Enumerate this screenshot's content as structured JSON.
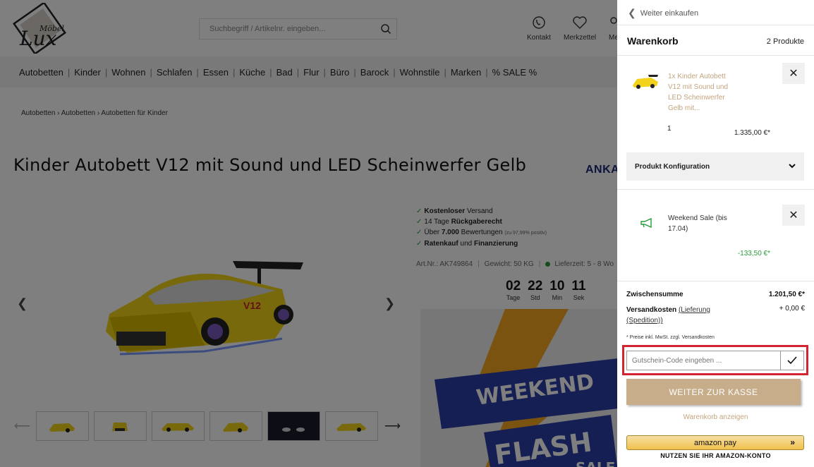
{
  "header": {
    "logo_text": "Möbel Lux",
    "search_placeholder": "Suchbegriff / Artikelnr. eingeben...",
    "icons": [
      {
        "label": "Kontakt",
        "icon": "phone-icon"
      },
      {
        "label": "Merkzettel",
        "icon": "heart-icon"
      },
      {
        "label": "Me",
        "icon": "user-icon"
      }
    ]
  },
  "nav": [
    "Autobetten",
    "Kinder",
    "Wohnen",
    "Schlafen",
    "Essen",
    "Küche",
    "Bad",
    "Flur",
    "Büro",
    "Barock",
    "Wohnstile",
    "Marken",
    "% SALE %"
  ],
  "breadcrumb": "Autobetten › Autobetten › Autobetten für Kinder",
  "product": {
    "title": "Kinder Autobett V12 mit Sound und LED Scheinwerfer Gelb",
    "brand": "ANKA",
    "features": [
      {
        "pre": "",
        "bold": "Kostenloser",
        "post": " Versand",
        "small": ""
      },
      {
        "pre": "14 Tage ",
        "bold": "Rückgaberecht",
        "post": "",
        "small": ""
      },
      {
        "pre": "Über ",
        "bold": "7.000",
        "post": " Bewertungen ",
        "small": "(zu 97,99% positiv)"
      },
      {
        "pre": "",
        "bold": "Ratenkauf",
        "post": " und ",
        "small": "",
        "bold2": "Finanzierung"
      }
    ],
    "art_nr": "Art.Nr.: AK749864",
    "weight": "Gewicht: 50 KG",
    "delivery": "Lieferzeit: 5 - 8 Wo",
    "countdown": [
      {
        "value": "02",
        "label": "Tage"
      },
      {
        "value": "22",
        "label": "Std"
      },
      {
        "value": "10",
        "label": "Min"
      },
      {
        "value": "11",
        "label": "Sek"
      }
    ],
    "banner_words": [
      "WEEKEND",
      "FLASH",
      "SALE"
    ]
  },
  "cart": {
    "back_label": "Weiter einkaufen",
    "title": "Warenkorb",
    "count": "2 Produkte",
    "item": {
      "name": "1x Kinder Autobett V12 mit Sound und LED Scheinwerfer Gelb mit...",
      "qty": "1",
      "price": "1.335,00 €*"
    },
    "config_label": "Produkt Konfiguration",
    "promo": {
      "name": "Weekend Sale (bis 17.04)",
      "price": "-133,50 €*"
    },
    "subtotal_label": "Zwischensumme",
    "subtotal_value": "1.201,50 €*",
    "shipping_label": "Versandkosten",
    "shipping_link": "(Lieferung (Spedition))",
    "shipping_value": "+ 0,00 €",
    "note": "* Preise inkl. MwSt. zzgl. Versandkosten",
    "coupon_placeholder": "Gutschein-Code eingeben ...",
    "checkout_label": "WEITER ZUR KASSE",
    "view_cart_label": "Warenkorb anzeigen",
    "amazon_label": "amazon pay",
    "amazon_sub": "NUTZEN SIE IHR AMAZON-KONTO"
  },
  "colors": {
    "accent": "#c8ad8b",
    "link": "#c4a47e",
    "discount": "#2a9b3a",
    "highlight": "#d42431",
    "amazon": "#f0c14b"
  }
}
